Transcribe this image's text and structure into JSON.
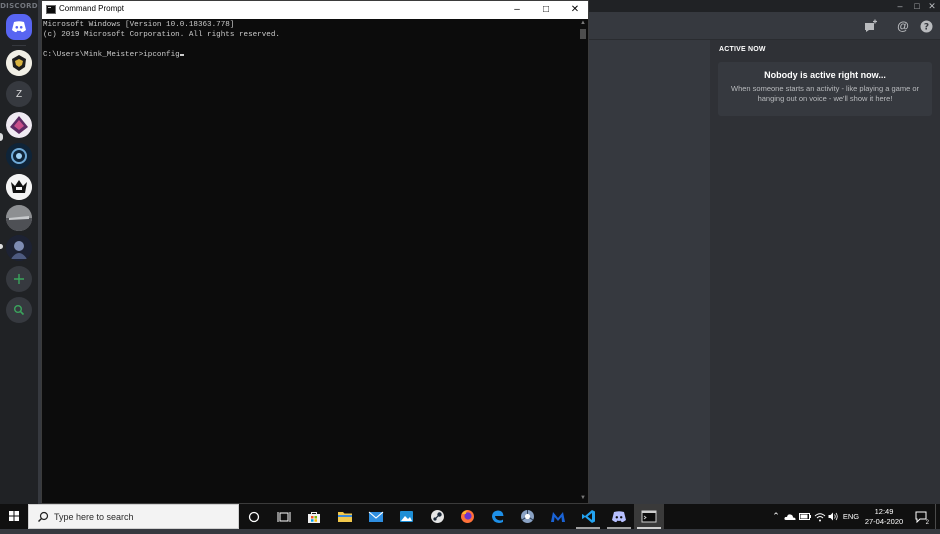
{
  "discord": {
    "brand": "DISCORD",
    "guilds": [
      {
        "name": "home-guild",
        "initial": ""
      },
      {
        "name": "guild-1",
        "initial": ""
      },
      {
        "name": "guild-z",
        "initial": "Z"
      },
      {
        "name": "guild-3",
        "initial": ""
      },
      {
        "name": "guild-4",
        "initial": ""
      },
      {
        "name": "guild-5",
        "initial": ""
      },
      {
        "name": "guild-6",
        "initial": ""
      },
      {
        "name": "guild-7",
        "initial": ""
      }
    ],
    "active_now": {
      "title": "ACTIVE NOW",
      "heading": "Nobody is active right now...",
      "body": "When someone starts an activity - like playing a game or hanging out on voice - we'll show it here!"
    },
    "colors": {
      "background": "#36393f",
      "rail": "#202225",
      "blurple": "#5865f2",
      "green": "#3ba55d"
    }
  },
  "cmd": {
    "title": "Command Prompt",
    "lines": [
      "Microsoft Windows [Version 10.0.18363.778]",
      "(c) 2019 Microsoft Corporation. All rights reserved.",
      "",
      "C:\\Users\\Mink_Meister>ipconfig"
    ]
  },
  "taskbar": {
    "search_placeholder": "Type here to search",
    "apps": [
      "cortana-icon",
      "task-view-icon",
      "store-icon",
      "file-explorer-icon",
      "mail-icon",
      "photos-icon",
      "steam-icon",
      "firefox-icon",
      "edge-icon",
      "chrome-icon",
      "malwarebytes-icon",
      "vscode-icon",
      "discord-icon",
      "command-prompt-icon"
    ],
    "language": "ENG",
    "time": "12:49",
    "date": "27-04-2020",
    "notification_count": "2"
  }
}
